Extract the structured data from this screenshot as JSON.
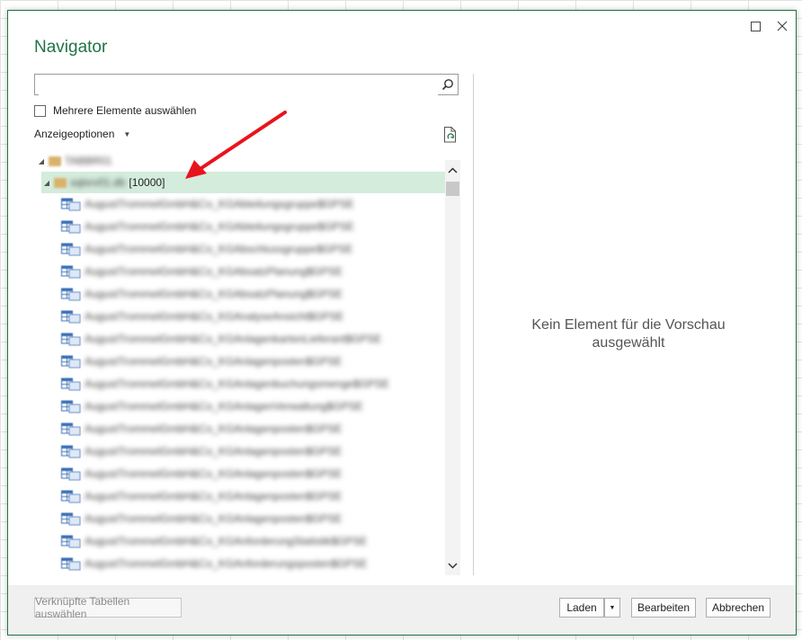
{
  "dialog": {
    "title": "Navigator",
    "maximize_icon": "maximize-icon",
    "close_icon": "close-icon",
    "accent": "#217346"
  },
  "search": {
    "value": "",
    "placeholder": "",
    "icon": "search-icon"
  },
  "multi_select": {
    "label": "Mehrere Elemente auswählen",
    "checked": false
  },
  "display_options": {
    "label": "Anzeigeoptionen",
    "icon": "chevron-down-icon"
  },
  "refresh": {
    "icon": "refresh-icon"
  },
  "tree": {
    "root": {
      "label": "TABBR01",
      "blurred": true
    },
    "database": {
      "label": "sqlsrv01.db",
      "count": "[10000]",
      "selected": true
    },
    "tables": [
      "AugustTrommelGmbH&Co_KGAbteilungsgruppe$GPSE",
      "AugustTrommelGmbH&Co_KGAbteilungsgruppe$GPSE",
      "AugustTrommelGmbH&Co_KGAbschlussgruppe$GPSE",
      "AugustTrommelGmbH&Co_KGAbsatzPlanung$GPSE",
      "AugustTrommelGmbH&Co_KGAbsatzPlanung$GPSE",
      "AugustTrommelGmbH&Co_KGAnalyseAnsicht$GPSE",
      "AugustTrommelGmbH&Co_KGAnlagenkartenLieferant$GPSE",
      "AugustTrommelGmbH&Co_KGAnlagenposten$GPSE",
      "AugustTrommelGmbH&Co_KGAnlagenbuchungsmenge$GPSE",
      "AugustTrommelGmbH&Co_KGAnlagenVerwaltung$GPSE",
      "AugustTrommelGmbH&Co_KGAnlagenposten$GPSE",
      "AugustTrommelGmbH&Co_KGAnlagenposten$GPSE",
      "AugustTrommelGmbH&Co_KGAnlagenposten$GPSE",
      "AugustTrommelGmbH&Co_KGAnlagenposten$GPSE",
      "AugustTrommelGmbH&Co_KGAnlagenposten$GPSE",
      "AugustTrommelGmbH&Co_KGAnforderungStatistik$GPSE",
      "AugustTrommelGmbH&Co_KGAnforderungsposten$GPSE"
    ]
  },
  "preview": {
    "empty_message": "Kein Element für die Vorschau ausgewählt"
  },
  "footer": {
    "related_tables": "Verknüpfte Tabellen auswählen",
    "load": "Laden",
    "edit": "Bearbeiten",
    "cancel": "Abbrechen"
  },
  "annotation": {
    "color": "#e8141c"
  }
}
